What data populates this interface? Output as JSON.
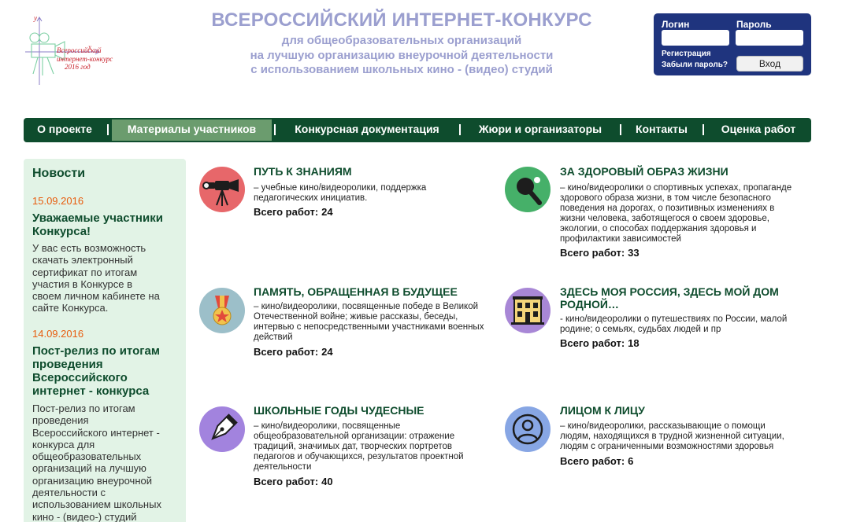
{
  "header": {
    "logo_lines": [
      "Всероссийский",
      "интернет-конкурс",
      "2016 год"
    ],
    "logo_axis_y": "y",
    "logo_axis_x": "x",
    "title": "ВСЕРОССИЙСКИЙ ИНТЕРНЕТ-КОНКУРС",
    "subtitle_lines": [
      "для общеобразовательных организаций",
      "на лучшую организацию внеурочной деятельности",
      "с использованием школьных кино - (видео) студий"
    ]
  },
  "login": {
    "login_label": "Логин",
    "password_label": "Пароль",
    "register_link": "Регистрация",
    "forgot_link": "Забыли пароль?",
    "submit_label": "Вход"
  },
  "nav": {
    "items": [
      {
        "label": "О проекте",
        "active": false
      },
      {
        "label": "Материалы участников",
        "active": true
      },
      {
        "label": "Конкурсная документация",
        "active": false
      },
      {
        "label": "Жюри и организаторы",
        "active": false
      },
      {
        "label": "Контакты",
        "active": false
      },
      {
        "label": "Оценка работ",
        "active": false
      }
    ]
  },
  "news": {
    "title": "Новости",
    "items": [
      {
        "date": "15.09.2016",
        "headline_lines": [
          "Уважаемые участники",
          "Конкурса!"
        ],
        "body_lines": [
          "У вас есть возможность",
          "скачать электронный",
          "сертификат по итогам",
          "участия в Конкурсе в",
          "своем личном кабинете на",
          "сайте Конкурса."
        ]
      },
      {
        "date": "14.09.2016",
        "headline_lines": [
          "Пост-релиз по итогам",
          "проведения",
          "Всероссийского",
          "интернет - конкурса"
        ],
        "body_lines": [
          "Пост-релиз по итогам",
          "проведения",
          "Всероссийского интернет -",
          "конкурса для",
          "общеобразовательных",
          "организаций на лучшую",
          "организацию внеурочной",
          "деятельности с",
          "использованием школьных",
          "кино - (видео-) студий"
        ]
      }
    ]
  },
  "categories": [
    {
      "title_lines": [
        "ПУТЬ К ЗНАНИЯМ"
      ],
      "desc_lines": [
        "– учебные кино/видеоролики, поддержка",
        "педагогических инициатив."
      ],
      "count_label": "Всего работ:",
      "count": "24",
      "icon": "camera-icon",
      "color": "#e7676a"
    },
    {
      "title_lines": [
        "ЗА ЗДОРОВЫЙ ОБРАЗ ЖИЗНИ"
      ],
      "desc_lines": [
        "– кино/видеоролики о спортивных успехах, пропаганде",
        "здорового образа жизни, в том числе безопасного",
        "поведения на дорогах, о позитивных изменениях в",
        "жизни человека, заботящегося о своем здоровье,",
        "экологии, о способах поддержания здоровья и",
        "профилактики зависимостей"
      ],
      "count_label": "Всего работ:",
      "count": "33",
      "icon": "ping-pong-icon",
      "color": "#46b069"
    },
    {
      "title_lines": [
        "ПАМЯТЬ, ОБРАЩЕННАЯ В БУДУЩЕЕ"
      ],
      "desc_lines": [
        "– кино/видеоролики, посвященные победе в Великой",
        "Отечественной войне; живые рассказы, беседы,",
        "интервью с непосредственными участниками военных",
        "действий"
      ],
      "count_label": "Всего работ:",
      "count": "24",
      "icon": "medal-icon",
      "color": "#9cbfc9"
    },
    {
      "title_lines": [
        "ЗДЕСЬ МОЯ РОССИЯ, ЗДЕСЬ МОЙ ДОМ",
        "РОДНОЙ…"
      ],
      "desc_lines": [
        "- кино/видеоролики о путешествиях по России, малой",
        "родине; о семьях, судьбах людей и пр"
      ],
      "count_label": "Всего работ:",
      "count": "18",
      "icon": "building-icon",
      "color": "#a887d6"
    },
    {
      "title_lines": [
        "ШКОЛЬНЫЕ ГОДЫ ЧУДЕСНЫЕ"
      ],
      "desc_lines": [
        "– кино/видеоролики, посвященные",
        "общеобразовательной организации: отражение",
        "традиций, значимых дат, творческих портретов",
        "педагогов и обучающихся, результатов проектной",
        "деятельности"
      ],
      "count_label": "Всего работ:",
      "count": "40",
      "icon": "pen-nib-icon",
      "color": "#a283de"
    },
    {
      "title_lines": [
        "ЛИЦОМ К ЛИЦУ"
      ],
      "desc_lines": [
        "– кино/видеоролики, рассказывающие о помощи",
        "людям, находящихся в трудной жизненной ситуации,",
        "людям с ограниченными возможностями здоровья"
      ],
      "count_label": "Всего работ:",
      "count": "6",
      "icon": "person-icon",
      "color": "#87a6e4"
    }
  ]
}
